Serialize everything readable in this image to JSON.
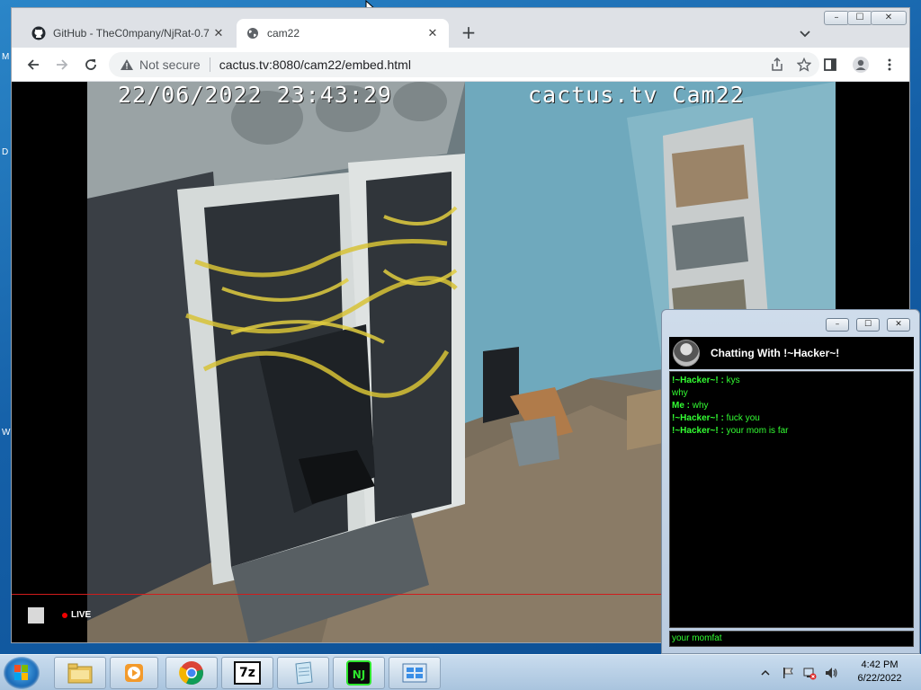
{
  "desktop": {
    "edge_labels": [
      "M",
      "D",
      "W"
    ]
  },
  "browser": {
    "tabs": [
      {
        "title": "GitHub - TheC0mpany/NjRat-0.7",
        "icon": "github-icon",
        "close": "✕"
      },
      {
        "title": "cam22",
        "icon": "globe-icon",
        "close": "✕"
      }
    ],
    "new_tab": "+",
    "window_controls": {
      "minimize": "–",
      "maximize": "☐",
      "close": "✕"
    },
    "security_label": "Not secure",
    "url_host": "cactus.tv",
    "url_rest": ":8080/cam22/embed.html"
  },
  "camera": {
    "timestamp": "22/06/2022 23:43:29",
    "camera_label": "cactus.tv  Cam22",
    "live_label": "LIVE"
  },
  "chat": {
    "title": "Chatting With !~Hacker~!",
    "messages": [
      {
        "sender": "!~Hacker~! :",
        "text": " kys"
      },
      {
        "sender": "",
        "text": "why"
      },
      {
        "sender": "Me :",
        "text": " why"
      },
      {
        "sender": "!~Hacker~! :",
        "text": " fuck you"
      },
      {
        "sender": "!~Hacker~! :",
        "text": " your mom is far"
      }
    ],
    "input_value": "your momfat",
    "colors": {
      "text": "#33ff33",
      "background": "#000000"
    }
  },
  "taskbar": {
    "apps": [
      "file-explorer-icon",
      "media-player-icon",
      "chrome-icon",
      "7zip-icon",
      "notepad-icon",
      "njrat-icon",
      "control-panel-icon"
    ],
    "seven_zip_label": "7z",
    "njrat_label": "NJ",
    "clock_time": "4:42 PM",
    "clock_date": "6/22/2022"
  }
}
